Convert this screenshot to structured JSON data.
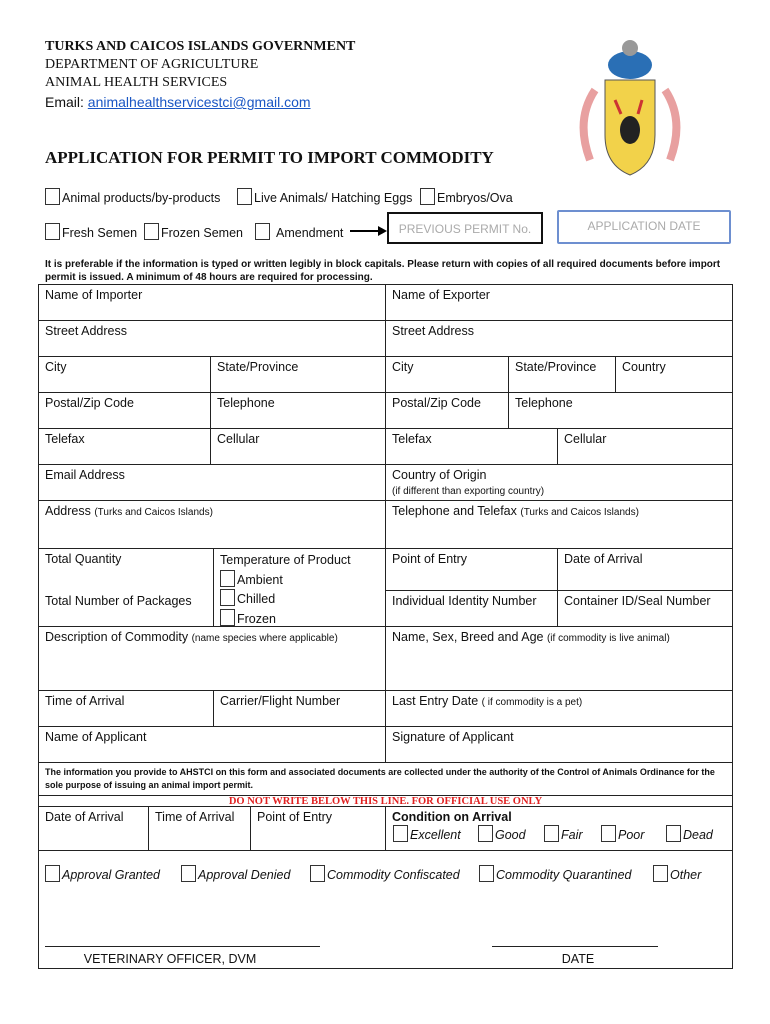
{
  "header": {
    "line1": "TURKS AND CAICOS ISLANDS GOVERNMENT",
    "line2": "DEPARTMENT OF AGRICULTURE",
    "line3": "ANIMAL HEALTH SERVICES",
    "email_label": "Email: ",
    "email": "animalhealthservicestci@gmail.com"
  },
  "title": "APPLICATION FOR PERMIT TO IMPORT COMMODITY",
  "options_row1": [
    "Animal products/by-products",
    "Live Animals/ Hatching Eggs",
    "Embryos/Ova"
  ],
  "options_row2": [
    "Fresh Semen",
    "Frozen Semen",
    "Amendment"
  ],
  "previous_permit_placeholder": "PREVIOUS PERMIT No.",
  "application_date_placeholder": "APPLICATION DATE",
  "instructions": "It is preferable if the information is typed or written legibly in block capitals. Please return with copies of all required documents before import permit is issued. A minimum of 48 hours are required for processing.",
  "fields": {
    "importer": "Name of Importer",
    "exporter": "Name of Exporter",
    "street_l": "Street Address",
    "street_r": "Street Address",
    "city_l": "City",
    "state_l": "State/Province",
    "city_r": "City",
    "state_r": "State/Province",
    "country_r": "Country",
    "postal_l": "Postal/Zip Code",
    "tel_l": "Telephone",
    "postal_r": "Postal/Zip Code",
    "tel_r": "Telephone",
    "telefax_l": "Telefax",
    "cell_l": "Cellular",
    "telefax_r": "Telefax",
    "cell_r": "Cellular",
    "email": "Email Address",
    "origin": "Country of Origin",
    "origin_note": "(if different than exporting country)",
    "address": "Address",
    "address_note": "(Turks and Caicos Islands)",
    "teltelefax": "Telephone and Telefax",
    "teltelefax_note": "(Turks and Caicos Islands)",
    "total_qty": "Total Quantity",
    "temp": "Temperature of Product",
    "temp_options": [
      "Ambient",
      "Chilled",
      "Frozen"
    ],
    "point_entry": "Point of Entry",
    "date_arrival": "Date of Arrival",
    "total_pkgs": "Total Number of Packages",
    "indiv_id": "Individual Identity Number",
    "container": "Container ID/Seal Number",
    "description": "Description of Commodity",
    "description_note": "(name species  where applicable)",
    "name_sex": "Name, Sex, Breed and Age",
    "name_sex_note": "(if commodity is live animal)",
    "time_arrival": "Time of Arrival",
    "carrier": "Carrier/Flight Number",
    "last_entry": "Last Entry Date",
    "last_entry_note": "( if commodity is a pet)",
    "applicant": "Name of Applicant",
    "signature": "Signature of Applicant"
  },
  "privacy_note": "The information you provide to AHSTCI on this form and associated documents are collected under the authority of the Control of Animals Ordinance for the sole purpose of issuing an animal import permit.",
  "official": {
    "warning": "DO NOT WRITE BELOW THIS LINE. FOR OFFICIAL USE ONLY",
    "date_arrival": "Date of Arrival",
    "time_arrival": "Time of Arrival",
    "point_entry": "Point of Entry",
    "condition": "Condition on Arrival",
    "conditions": [
      "Excellent",
      "Good",
      "Fair",
      "Poor",
      "Dead"
    ],
    "decisions": [
      "Approval Granted",
      "Approval Denied",
      "Commodity Confiscated",
      "Commodity Quarantined",
      "Other"
    ],
    "officer": "VETERINARY OFFICER, DVM",
    "date": "DATE"
  },
  "colors": {
    "link": "#1a56c4",
    "warning": "#e02020",
    "app_date_border": "#6d8fd0"
  }
}
